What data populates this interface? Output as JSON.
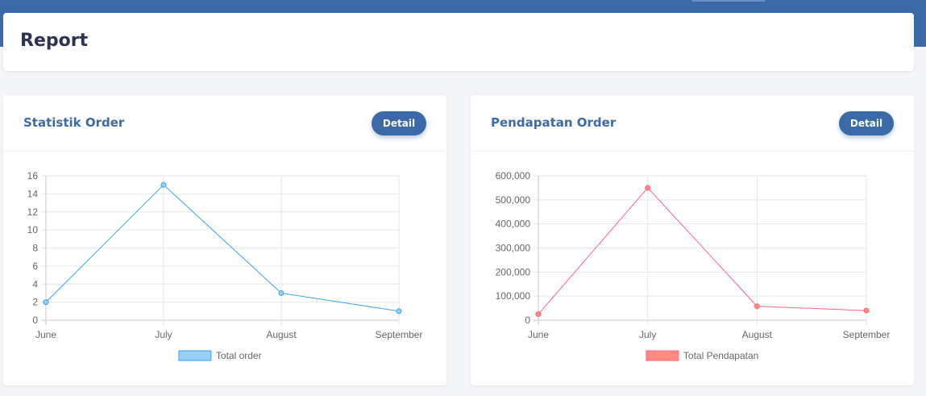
{
  "header": {
    "title": "Report"
  },
  "cards": [
    {
      "title": "Statistik Order",
      "button_label": "Detail"
    },
    {
      "title": "Pendapatan Order",
      "button_label": "Detail"
    }
  ],
  "chart_data": [
    {
      "type": "line",
      "categories": [
        "June",
        "July",
        "August",
        "September"
      ],
      "series": [
        {
          "name": "Total order",
          "values": [
            2,
            15,
            3,
            1
          ],
          "color": "#36a2eb",
          "fill": "#9ad0f5"
        }
      ],
      "ylim": [
        0,
        16
      ],
      "yticks": [
        0,
        2,
        4,
        6,
        8,
        10,
        12,
        14,
        16
      ],
      "ytick_labels": [
        "0",
        "2",
        "4",
        "6",
        "8",
        "10",
        "12",
        "14",
        "16"
      ],
      "grid": true,
      "legend": "bottom"
    },
    {
      "type": "line",
      "categories": [
        "June",
        "July",
        "August",
        "September"
      ],
      "series": [
        {
          "name": "Total Pendapatan",
          "values": [
            25000,
            550000,
            58000,
            40000
          ],
          "color": "#ff6384",
          "fill": "#ff8a80"
        }
      ],
      "ylim": [
        0,
        600000
      ],
      "yticks": [
        0,
        100000,
        200000,
        300000,
        400000,
        500000,
        600000
      ],
      "ytick_labels": [
        "0",
        "100,000",
        "200,000",
        "300,000",
        "400,000",
        "500,000",
        "600,000"
      ],
      "grid": true,
      "legend": "bottom"
    }
  ]
}
